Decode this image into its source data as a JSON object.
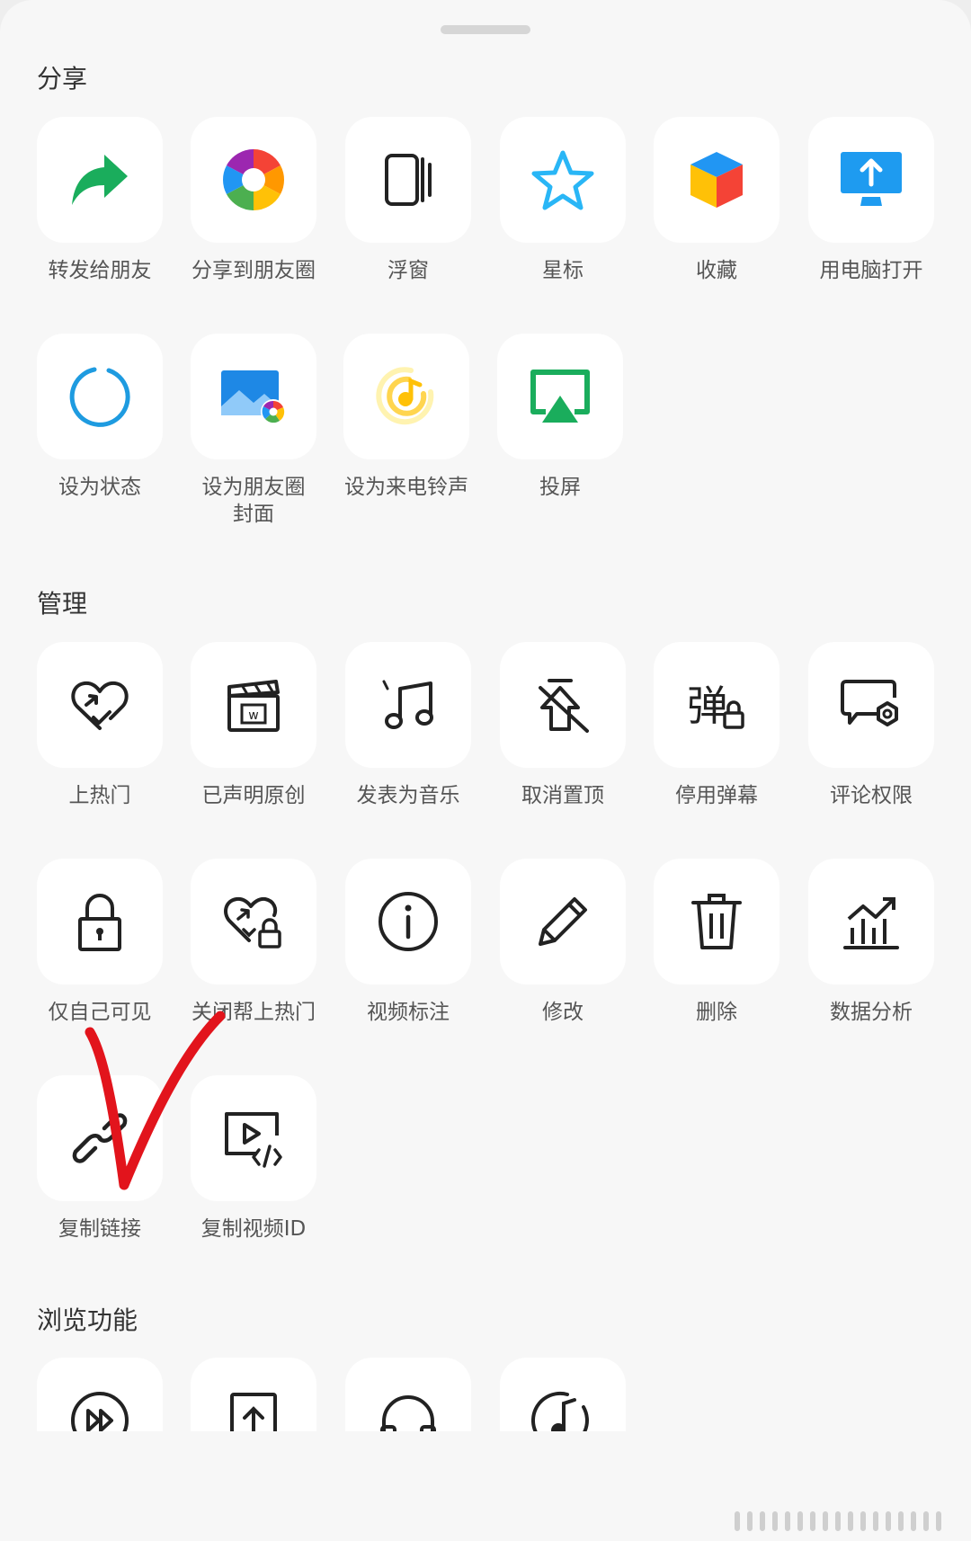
{
  "sections": {
    "share": {
      "title": "分享"
    },
    "manage": {
      "title": "管理"
    },
    "browse": {
      "title": "浏览功能"
    }
  },
  "share_items": [
    {
      "label": "转发给朋友",
      "icon": "forward-icon"
    },
    {
      "label": "分享到朋友圈",
      "icon": "moments-icon"
    },
    {
      "label": "浮窗",
      "icon": "float-window-icon"
    },
    {
      "label": "星标",
      "icon": "star-icon"
    },
    {
      "label": "收藏",
      "icon": "favorite-cube-icon"
    },
    {
      "label": "用电脑打开",
      "icon": "open-on-pc-icon"
    },
    {
      "label": "设为状态",
      "icon": "status-ring-icon"
    },
    {
      "label": "设为朋友圈\n封面",
      "icon": "moments-cover-icon"
    },
    {
      "label": "设为来电铃声",
      "icon": "ringtone-icon"
    },
    {
      "label": "投屏",
      "icon": "cast-screen-icon"
    }
  ],
  "manage_items": [
    {
      "label": "上热门",
      "icon": "heart-promote-icon"
    },
    {
      "label": "已声明原创",
      "icon": "original-clapper-icon"
    },
    {
      "label": "发表为音乐",
      "icon": "music-note-icon"
    },
    {
      "label": "取消置顶",
      "icon": "unpin-icon"
    },
    {
      "label": "停用弹幕",
      "icon": "danmaku-lock-icon"
    },
    {
      "label": "评论权限",
      "icon": "comment-settings-icon"
    },
    {
      "label": "仅自己可见",
      "icon": "lock-icon"
    },
    {
      "label": "关闭帮上热门",
      "icon": "heart-lock-icon"
    },
    {
      "label": "视频标注",
      "icon": "info-icon"
    },
    {
      "label": "修改",
      "icon": "pencil-icon"
    },
    {
      "label": "删除",
      "icon": "trash-icon"
    },
    {
      "label": "数据分析",
      "icon": "analytics-icon"
    },
    {
      "label": "复制链接",
      "icon": "link-icon"
    },
    {
      "label": "复制视频ID",
      "icon": "video-id-icon"
    }
  ],
  "browse_items": [
    {
      "icon": "fast-forward-icon"
    },
    {
      "icon": "upload-icon"
    },
    {
      "icon": "headphones-icon"
    },
    {
      "icon": "music-circle-icon"
    }
  ],
  "colors": {
    "accent_green": "#1aad5c",
    "accent_blue": "#1e88e5",
    "annotation_red": "#e2141c"
  }
}
